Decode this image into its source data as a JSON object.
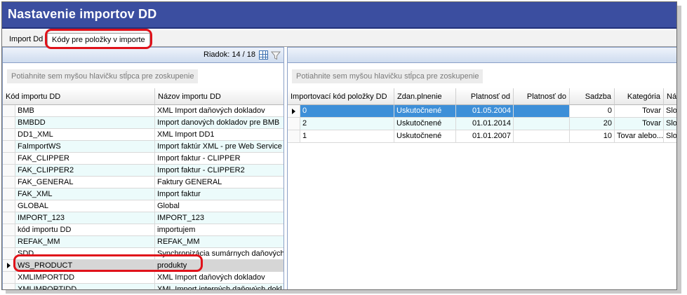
{
  "window": {
    "title": "Nastavenie importov DD"
  },
  "tabs": [
    {
      "label": "Import Dd"
    },
    {
      "label": "Kódy pre položky v importe"
    }
  ],
  "left_pane": {
    "row_counter": "Riadok: 14 / 18",
    "group_hint": "Potiahnite sem myšou hlavičku stĺpca pre zoskupenie",
    "columns": [
      "Kód importu DD",
      "Názov importu DD"
    ],
    "rows": [
      {
        "code": "BMB",
        "name": "XML Import daňových dokladov"
      },
      {
        "code": "BMBDD",
        "name": "Import danových dokladov pre BMB"
      },
      {
        "code": "DD1_XML",
        "name": "XML Import DD1"
      },
      {
        "code": "FaImportWS",
        "name": "Import faktúr XML - pre Web Service"
      },
      {
        "code": "FAK_CLIPPER",
        "name": "Import faktur - CLIPPER"
      },
      {
        "code": "FAK_CLIPPER2",
        "name": "Import faktur - CLIPPER2"
      },
      {
        "code": "FAK_GENERAL",
        "name": "Faktury GENERAL"
      },
      {
        "code": "FAK_XML",
        "name": "Import faktur"
      },
      {
        "code": "GLOBAL",
        "name": "Global"
      },
      {
        "code": "IMPORT_123",
        "name": "IMPORT_123"
      },
      {
        "code": "kód importu DD",
        "name": "importujem"
      },
      {
        "code": "REFAK_MM",
        "name": "REFAK_MM"
      },
      {
        "code": "SDD",
        "name": "Synchronizácia sumárnych daňových"
      },
      {
        "code": "WS_PRODUCT",
        "name": "produkty"
      },
      {
        "code": "XMLIMPORTDD",
        "name": "XML Import daňových dokladov"
      },
      {
        "code": "XMLIMPORTIDD",
        "name": "XML Import interných daňových dokl"
      }
    ]
  },
  "right_pane": {
    "group_hint": "Potiahnite sem myšou hlavičku stĺpca pre zoskupenie",
    "columns": [
      "Importovací kód položky DD",
      "Zdan.plnenie",
      "Platnosť od",
      "Platnosť do",
      "Sadzba",
      "Kategória",
      "Náz"
    ],
    "rows": [
      {
        "kod": "0",
        "zdan": "Uskutočnené",
        "od": "01.05.2004",
        "do": "",
        "sadzba": "0",
        "kategoria": "Tovar",
        "naz": "Slov"
      },
      {
        "kod": "2",
        "zdan": "Uskutočnené",
        "od": "01.01.2014",
        "do": "",
        "sadzba": "20",
        "kategoria": "Tovar",
        "naz": "Slov"
      },
      {
        "kod": "1",
        "zdan": "Uskutočnené",
        "od": "01.01.2007",
        "do": "",
        "sadzba": "10",
        "kategoria": "Tovar alebo...",
        "naz": "Slov"
      }
    ]
  },
  "icons": [
    "grid-icon",
    "filter-icon",
    "row-pointer-icon"
  ],
  "colors": {
    "title_bar": "#3b4ea0",
    "highlight": "#e0121a",
    "selection": "#3d8fd8",
    "alt_row": "#ecfbfb"
  }
}
